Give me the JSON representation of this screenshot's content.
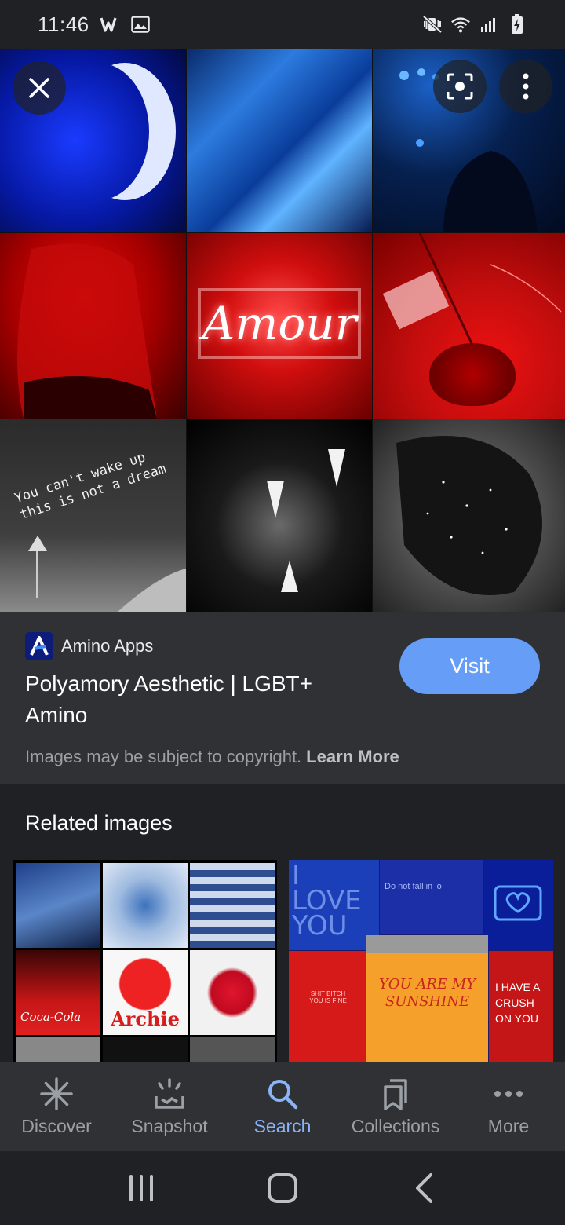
{
  "status_bar": {
    "time": "11:46",
    "left_icons": [
      "w-app-icon",
      "gallery-icon"
    ],
    "right_icons": [
      "mute-vibrate-icon",
      "wifi-icon",
      "signal-icon",
      "battery-charging-icon"
    ]
  },
  "hero": {
    "neon_sign_text": "Amour",
    "dream_text_line1": "You can't wake up",
    "dream_text_line2": "this is not a dream",
    "overlay_buttons": [
      "close-icon",
      "lens-icon",
      "more-vert-icon"
    ]
  },
  "result": {
    "source_logo_letter": "A",
    "source_name": "Amino Apps",
    "title": "Polyamory Aesthetic | LGBT+ Amino",
    "visit_label": "Visit",
    "copyright_text": "Images may be subject to copyright.",
    "learn_more_label": "Learn More"
  },
  "related": {
    "heading": "Related images",
    "card1_caption_archie": "Archie",
    "card1_caption_coke": "Coca-Cola",
    "card2_love_line1": "I",
    "card2_love_line2": "LOVE",
    "card2_love_line3": "YOU",
    "card2_fall_text": "Do not fall in lo",
    "card2_sunshine": "YOU ARE MY SUNSHINE",
    "card2_crush": "I HAVE A CRUSH ON YOU",
    "card2_bear_text": "SHIT BITCH YOU IS FINE"
  },
  "bottom_nav": {
    "items": [
      {
        "label": "Discover",
        "icon": "asterisk-icon"
      },
      {
        "label": "Snapshot",
        "icon": "snapshot-icon"
      },
      {
        "label": "Search",
        "icon": "search-icon"
      },
      {
        "label": "Collections",
        "icon": "bookmarks-icon"
      },
      {
        "label": "More",
        "icon": "more-horiz-icon"
      }
    ],
    "active": "Search"
  },
  "system_nav": [
    "recents-icon",
    "home-icon",
    "back-icon"
  ],
  "colors": {
    "background": "#202124",
    "panel": "#303134",
    "accent": "#8ab4f8",
    "visit_button": "#669df6"
  }
}
